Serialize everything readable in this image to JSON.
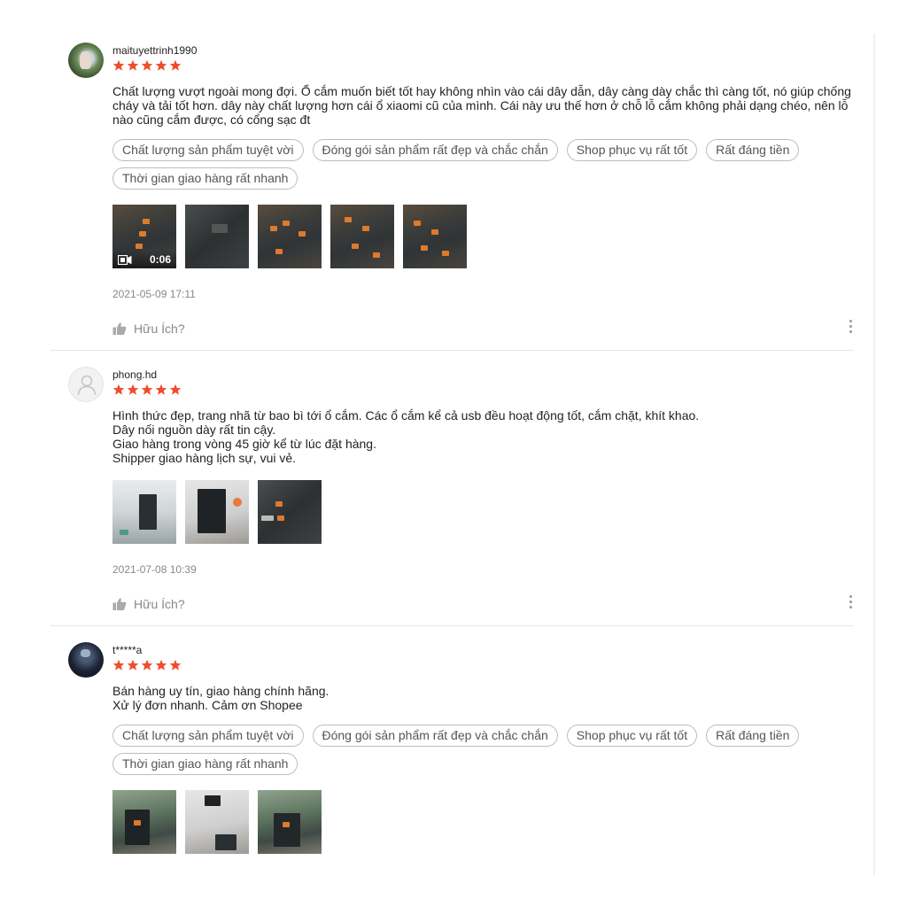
{
  "colors": {
    "star": "#ee4d2d",
    "tag_border": "rgba(0,0,0,0.26)",
    "divider": "#e5e5e5"
  },
  "reviews": [
    {
      "username": "maituyettrinh1990",
      "rating": 5,
      "content": "Chất lượng vượt ngoài mong đợi. Ổ cắm muốn biết tốt hay không nhìn vào cái dây dẫn, dây càng dày chắc thì càng tốt, nó giúp chống cháy và tải tốt hơn. dây này chất lượng hơn cái ổ xiaomi cũ của mình. Cái này ưu thế hơn ở chỗ lỗ cắm không phải dạng chéo, nên lỗ nào cũng cắm được, có cổng sạc đt",
      "tags": [
        "Chất lượng sản phẩm tuyệt vời",
        "Đóng gói sản phẩm rất đẹp và chắc chắn",
        "Shop phục vụ rất tốt",
        "Rất đáng tiền",
        "Thời gian giao hàng rất nhanh"
      ],
      "video_duration": "0:06",
      "time": "2021-05-09 17:11",
      "helpful_label": "Hữu Ích?"
    },
    {
      "username": "phong.hd",
      "rating": 5,
      "content": "Hình thức đẹp, trang nhã từ bao bì tới ổ cắm. Các ổ cắm kể cả usb đều hoạt động tốt, cắm chặt, khít khao.\nDây nối nguồn dày rất tin cậy.\nGiao hàng trong vòng 45 giờ kể từ lúc đặt hàng.\nShipper giao hàng lịch sự, vui vẻ.",
      "time": "2021-07-08 10:39",
      "helpful_label": "Hữu Ích?"
    },
    {
      "username": "t*****a",
      "rating": 5,
      "content": "Bán hàng uy tín, giao hàng chính hãng.\nXử lý đơn nhanh. Cảm ơn Shopee",
      "tags": [
        "Chất lượng sản phẩm tuyệt vời",
        "Đóng gói sản phẩm rất đẹp và chắc chắn",
        "Shop phục vụ rất tốt",
        "Rất đáng tiền",
        "Thời gian giao hàng rất nhanh"
      ]
    }
  ]
}
